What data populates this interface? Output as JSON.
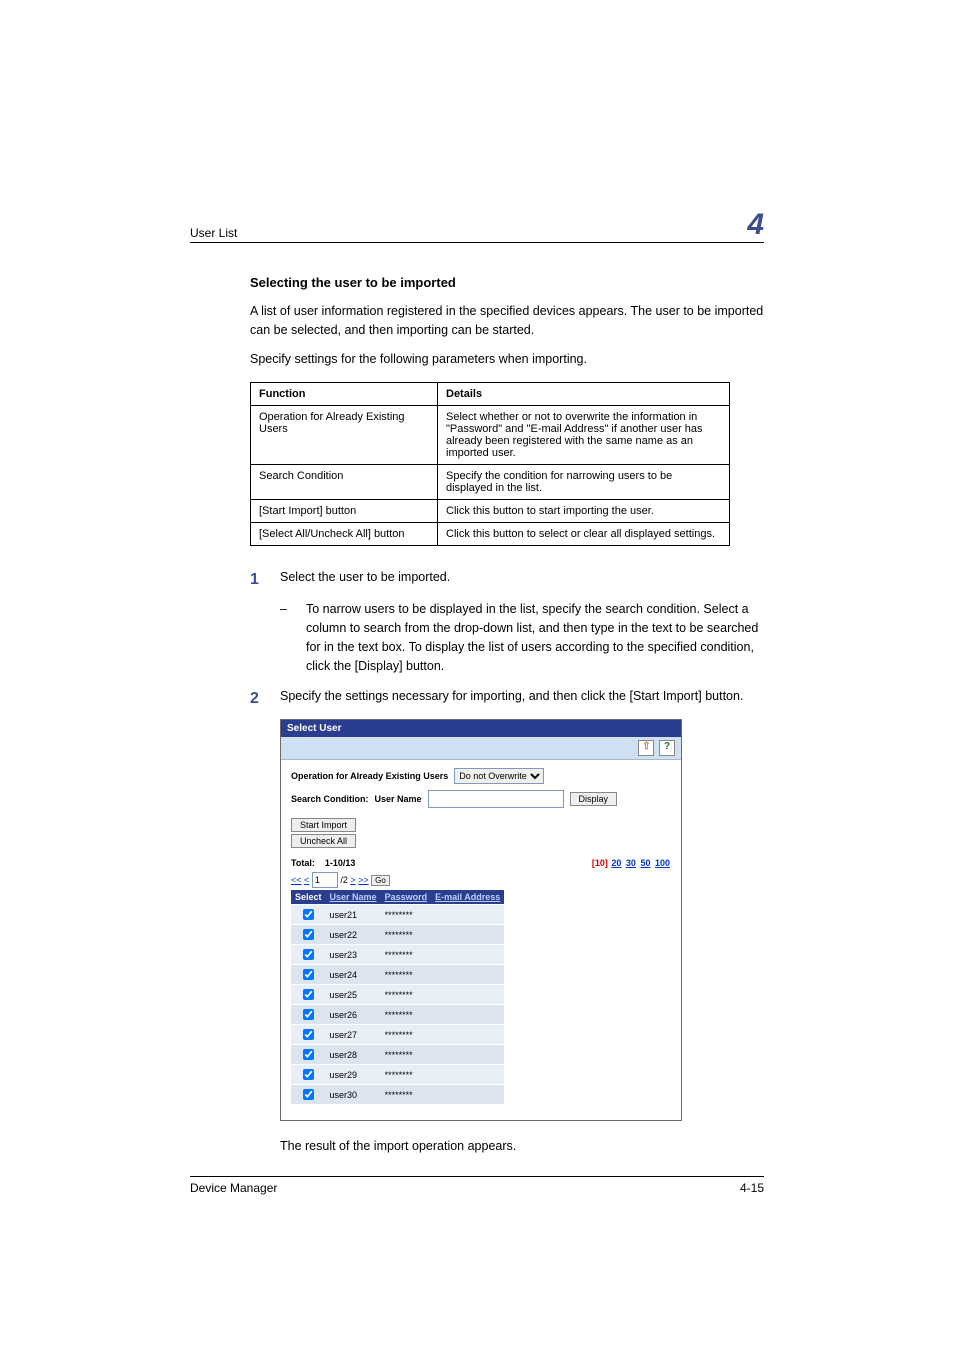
{
  "header": {
    "title": "User List",
    "chapter": "4"
  },
  "section": {
    "heading": "Selecting the user to be imported",
    "p1": "A list of user information registered in the specified devices appears. The user to be imported can be selected, and then importing can be started.",
    "p2": "Specify settings for the following parameters when importing."
  },
  "func_table": {
    "head_func": "Function",
    "head_details": "Details",
    "rows": [
      {
        "f": "Operation for Already Existing Users",
        "d": "Select whether or not to overwrite the information in \"Password\" and \"E-mail Address\" if another user has already been registered with the same name as an imported user."
      },
      {
        "f": "Search Condition",
        "d": "Specify the condition for narrowing users to be displayed in the list."
      },
      {
        "f": "[Start Import] button",
        "d": "Click this button to start importing the user."
      },
      {
        "f": "[Select All/Uncheck All] button",
        "d": "Click this button to select or clear all displayed settings."
      }
    ]
  },
  "steps": {
    "s1_num": "1",
    "s1_text": "Select the user to be imported.",
    "s1_sub_dash": "–",
    "s1_sub": "To narrow users to be displayed in the list, specify the search condition. Select a column to search from the drop-down list, and then type in the text to be searched for in the text box. To display the list of users according to the specified condition, click the [Display] button.",
    "s2_num": "2",
    "s2_text": "Specify the settings necessary for importing, and then click the [Start Import] button."
  },
  "shot": {
    "title": "Select User",
    "icon_back": "⇧",
    "icon_help": "?",
    "op_label": "Operation for Already Existing Users",
    "op_value": "Do not Overwrite",
    "search_label": "Search Condition:",
    "search_column": "User Name",
    "search_value": "",
    "display_btn": "Display",
    "start_import_btn": "Start Import",
    "uncheck_all_btn": "Uncheck All",
    "total_label": "Total:",
    "total_range": "1-10/13",
    "page_size_current": "[10]",
    "page_sizes": [
      "20",
      "30",
      "50",
      "100"
    ],
    "pager_first": "<<",
    "pager_prev": "<",
    "pager_page": "1",
    "pager_total": "/2",
    "pager_next": ">",
    "pager_last": ">>",
    "pager_go": "Go",
    "cols": {
      "select": "Select",
      "user": "User Name",
      "pwd": "Password",
      "email": "E-mail Address"
    },
    "rows": [
      {
        "checked": true,
        "user": "user21",
        "pwd": "********",
        "email": ""
      },
      {
        "checked": true,
        "user": "user22",
        "pwd": "********",
        "email": ""
      },
      {
        "checked": true,
        "user": "user23",
        "pwd": "********",
        "email": ""
      },
      {
        "checked": true,
        "user": "user24",
        "pwd": "********",
        "email": ""
      },
      {
        "checked": true,
        "user": "user25",
        "pwd": "********",
        "email": ""
      },
      {
        "checked": true,
        "user": "user26",
        "pwd": "********",
        "email": ""
      },
      {
        "checked": true,
        "user": "user27",
        "pwd": "********",
        "email": ""
      },
      {
        "checked": true,
        "user": "user28",
        "pwd": "********",
        "email": ""
      },
      {
        "checked": true,
        "user": "user29",
        "pwd": "********",
        "email": ""
      },
      {
        "checked": true,
        "user": "user30",
        "pwd": "********",
        "email": ""
      }
    ]
  },
  "after_shot": "The result of the import operation appears.",
  "footer": {
    "left": "Device Manager",
    "right": "4-15"
  }
}
